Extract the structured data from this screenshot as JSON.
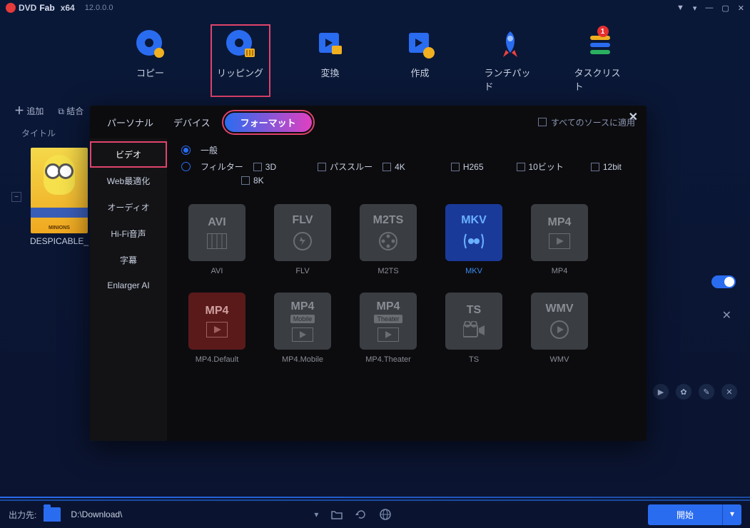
{
  "titlebar": {
    "brand_prefix": "DVD",
    "brand_suffix": "Fab",
    "arch": "x64",
    "version": "12.0.0.0"
  },
  "main_tabs": {
    "copy": "コピー",
    "ripping": "リッピング",
    "convert": "変換",
    "create": "作成",
    "launchpad": "ランチパッド",
    "tasklist": "タスクリスト",
    "task_badge": "1"
  },
  "sub_toolbar": {
    "add": "追加",
    "merge": "結合"
  },
  "content": {
    "title_header": "タイトル",
    "item_title": "DESPICABLE_"
  },
  "modal": {
    "tabs": {
      "personal": "パーソナル",
      "device": "デバイス",
      "format": "フォーマット"
    },
    "apply_all": "すべてのソースに適用",
    "sidebar": {
      "video": "ビデオ",
      "web": "Web最適化",
      "audio": "オーディオ",
      "hifi": "Hi-Fi音声",
      "subtitle": "字幕",
      "enlarger": "Enlarger AI"
    },
    "filters": {
      "general": "一般",
      "filter": "フィルター",
      "threeD": "3D",
      "passthrough": "パススルー",
      "fourK": "4K",
      "h265": "H265",
      "tenBit": "10ビット",
      "twelveBit": "12bit",
      "eightK": "8K"
    },
    "formats": {
      "avi": {
        "tile": "AVI",
        "label": "AVI"
      },
      "flv": {
        "tile": "FLV",
        "label": "FLV"
      },
      "m2ts": {
        "tile": "M2TS",
        "label": "M2TS"
      },
      "mkv": {
        "tile": "MKV",
        "label": "MKV"
      },
      "mp4": {
        "tile": "MP4",
        "label": "MP4"
      },
      "mp4_default": {
        "tile": "MP4",
        "label": "MP4.Default"
      },
      "mp4_mobile": {
        "tile": "MP4",
        "sub": "Mobile",
        "label": "MP4.Mobile"
      },
      "mp4_theater": {
        "tile": "MP4",
        "sub": "Theater",
        "label": "MP4.Theater"
      },
      "ts": {
        "tile": "TS",
        "label": "TS"
      },
      "wmv": {
        "tile": "WMV",
        "label": "WMV"
      }
    }
  },
  "bottom": {
    "out_label": "出力先:",
    "path": "D:\\Download\\",
    "start": "開始"
  }
}
